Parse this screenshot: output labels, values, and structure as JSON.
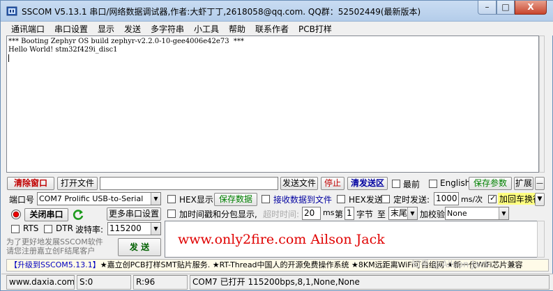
{
  "window": {
    "title": "SSCOM V5.13.1 串口/网络数据调试器,作者:大虾丁丁,2618058@qq.com. QQ群：52502449(最新版本)",
    "min_glyph": "–",
    "max_glyph": "□",
    "close_glyph": "X"
  },
  "menu": [
    "通讯端口",
    "串口设置",
    "显示",
    "发送",
    "多字符串",
    "小工具",
    "帮助",
    "联系作者",
    "PCB打样"
  ],
  "terminal": {
    "lines": [
      "*** Booting Zephyr OS build zephyr-v2.2.0-10-gee4006e42e73  ***",
      "Hello World! stm32f429i_disc1"
    ]
  },
  "row1": {
    "clear_window": "清除窗口",
    "open_file": "打开文件",
    "file_path": "",
    "send_file": "发送文件",
    "stop": "停止",
    "clear_send": "清发送区",
    "topmost": "最前",
    "english": "English",
    "save_params": "保存参数",
    "expand": "扩展",
    "minus": "—"
  },
  "row2": {
    "port_label": "端口号",
    "port_value": "COM7 Prolific USB-to-Serial",
    "hex_display": "HEX显示",
    "save_data": "保存数据",
    "recv_to_file": "接收数据到文件",
    "hex_send": "HEX发送",
    "timed_send": "定时发送:",
    "interval": "1000",
    "interval_unit": "ms/次",
    "add_crlf": "加回车换行"
  },
  "row3": {
    "close_port": "关闭串口",
    "more_settings": "更多串口设置",
    "timestamp": "加时间戳和分包显示,",
    "timeout_label": "超时时间:",
    "timeout": "20",
    "timeout_unit": "ms",
    "byte_label": "第",
    "byte_index": "1",
    "byte_unit": "字节",
    "to_label": "至",
    "to_value": "末尾",
    "checksum_label": "加校验",
    "checksum_value": "None"
  },
  "row4": {
    "rts": "RTS",
    "dtr": "DTR",
    "baud_label": "波特率:",
    "baud_value": "115200"
  },
  "send_area": {
    "watermark_text": "www.only2fire.com  Ailson Jack"
  },
  "promo": {
    "line1": "为了更好地发展SSCOM软件",
    "line2": "请您注册嘉立创F结尾客户"
  },
  "send_button": "发  送",
  "ticker": {
    "part1": "【升级到SSCOM5.13.1】",
    "part2": "★嘉立创PCB打样SMT贴片服务. ★RT-Thread中国人的开源免费操作系统 ★8KM远距离WiFi可自组网 ★新一代WiFi芯片兼容",
    "overlay": "知乎 @Ailson Jack"
  },
  "status": {
    "site": "www.daxia.com",
    "sent": "S:0",
    "received": "R:96",
    "port_state": "COM7 已打开  115200bps,8,1,None,None"
  }
}
